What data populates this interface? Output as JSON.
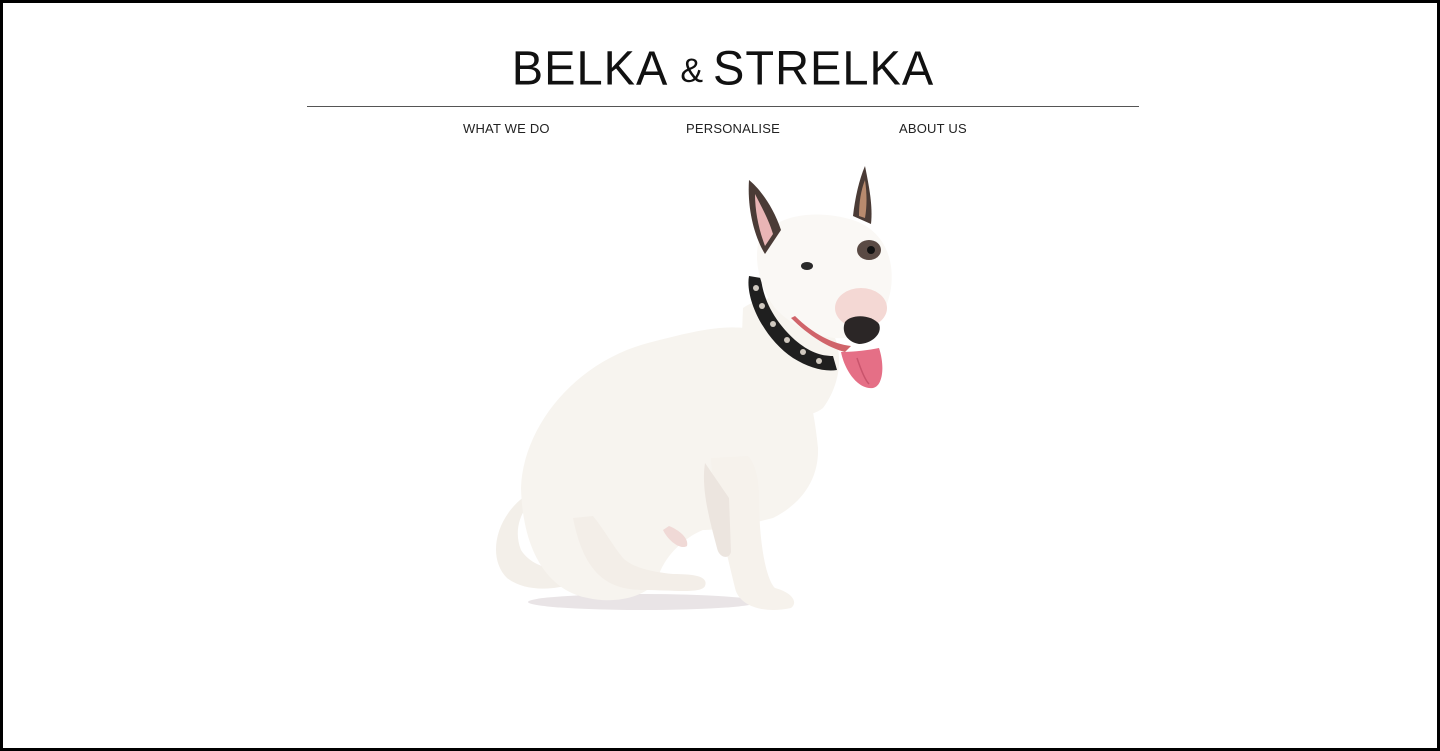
{
  "brand": {
    "name_left": "BELKA",
    "ampersand": "&",
    "name_right": "STRELKA"
  },
  "nav": {
    "items": [
      {
        "label": "WHAT WE DO"
      },
      {
        "label": "PERSONALISE"
      },
      {
        "label": "ABOUT US"
      }
    ]
  },
  "hero": {
    "image": "bull-terrier-dog-photo"
  },
  "colors": {
    "text": "#111111",
    "rule": "#555555",
    "background": "#ffffff",
    "frame": "#000000"
  }
}
